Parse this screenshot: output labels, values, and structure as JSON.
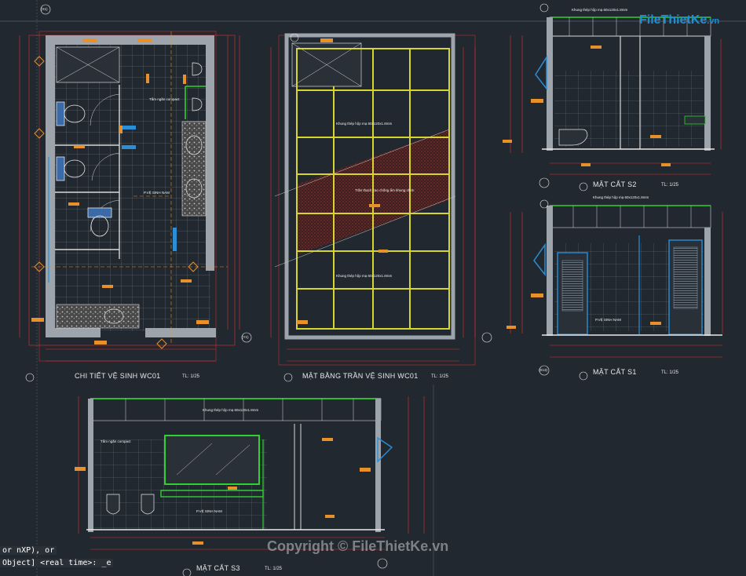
{
  "logo": {
    "text": "FileThietKe",
    "suffix": ".vn"
  },
  "views": {
    "wc01_detail": {
      "title": "CHI TIẾT VỆ SINH WC01",
      "scale": "TL: 1/25"
    },
    "ceiling_plan": {
      "title": "MẶT BẰNG TRẦN VỆ SINH WC01",
      "scale": "TL: 1/25"
    },
    "section_s2": {
      "title": "MẶT CẮT S2",
      "scale": "TL: 1/25"
    },
    "section_s1": {
      "title": "MẶT CẮT S1",
      "scale": "TL: 1/25"
    },
    "section_s3": {
      "title": "MẶT CẮT S3",
      "scale": "TL: 1/25"
    }
  },
  "notes": {
    "partition": "Tấm ngăn compact",
    "frame": "Khung thép hộp mạ 60x120x1.8mm",
    "pvc": "P.VỆ SINH NAM",
    "ceiling_plaster": "Trần thạch cao chống ẩm khung chìm"
  },
  "grid_labels": {
    "x1": "(X1)",
    "y1": "(Y1)",
    "x13": "(X13)"
  },
  "command_line": {
    "line1": "or nXP), or",
    "line2": "Object] <real time>: _e"
  },
  "watermark": "Copyright © FileThietKe.vn",
  "colors": {
    "background": "#212830",
    "dim": "#e0302a",
    "frame": "#d6d62e",
    "wall": "#b8b8b8",
    "green": "#2fd12f",
    "blue": "#2a8fd6",
    "orange": "#e8902a"
  }
}
